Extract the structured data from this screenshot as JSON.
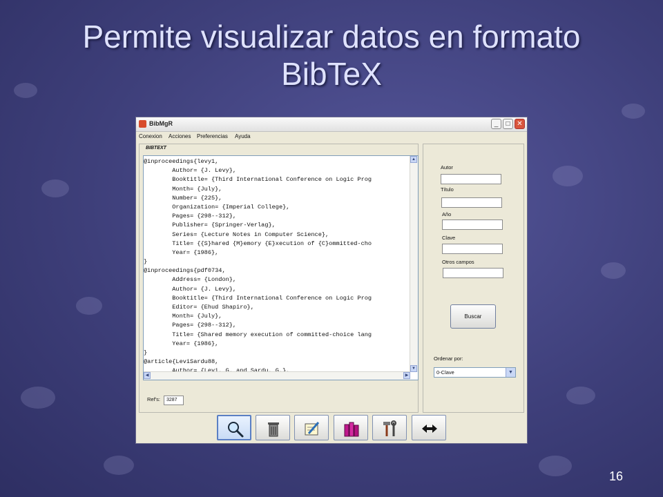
{
  "slide": {
    "title_line1": "Permite visualizar datos en formato",
    "title_line2": "BibTeX",
    "number": "16"
  },
  "app": {
    "title": "BibMgR",
    "menu": [
      "Conexion",
      "Acciones",
      "Preferencias",
      "Ayuda"
    ],
    "window_buttons": {
      "minimize": "_",
      "maximize": "□",
      "close": "✕"
    }
  },
  "editor": {
    "label": "BIBTEXT",
    "lines": [
      "@inproceedings{levy1,",
      "        Author= {J. Levy},",
      "        Booktitle= {Third International Conference on Logic Prog",
      "        Month= {July},",
      "        Number= {225},",
      "        Organization= {Imperial College},",
      "        Pages= {298--312},",
      "        Publisher= {Springer-Verlag},",
      "        Series= {Lecture Notes in Computer Science},",
      "        Title= {{S}hared {M}emory {E}xecution of {C}ommitted-cho",
      "        Year= {1986},",
      "}",
      "@inproceedings{pdf0734,",
      "        Address= {London},",
      "        Author= {J. Levy},",
      "        Booktitle= {Third International Conference on Logic Prog",
      "        Editor= {Ehud Shapiro},",
      "        Month= {July},",
      "        Pages= {298--312},",
      "        Title= {Shared memory execution of committed-choice lang",
      "        Year= {1986},",
      "}",
      "@article{LeviSardu88,",
      "        Author= {Levi, G. and Sardu, G.},"
    ]
  },
  "refs": {
    "label": "Ref's:",
    "value": "3287"
  },
  "search": {
    "fields": [
      {
        "label": "Autor",
        "value": ""
      },
      {
        "label": "Título",
        "value": ""
      },
      {
        "label": "Año",
        "value": ""
      },
      {
        "label": "Clave",
        "value": ""
      },
      {
        "label": "Otros campos",
        "value": ""
      }
    ],
    "button_label": "Buscar",
    "order_label": "Ordenar por:",
    "order_value": "0-Clave"
  },
  "toolbar": {
    "buttons": [
      "search-icon",
      "trash-icon",
      "edit-icon",
      "books-icon",
      "tools-icon",
      "swap-arrows-icon"
    ]
  }
}
